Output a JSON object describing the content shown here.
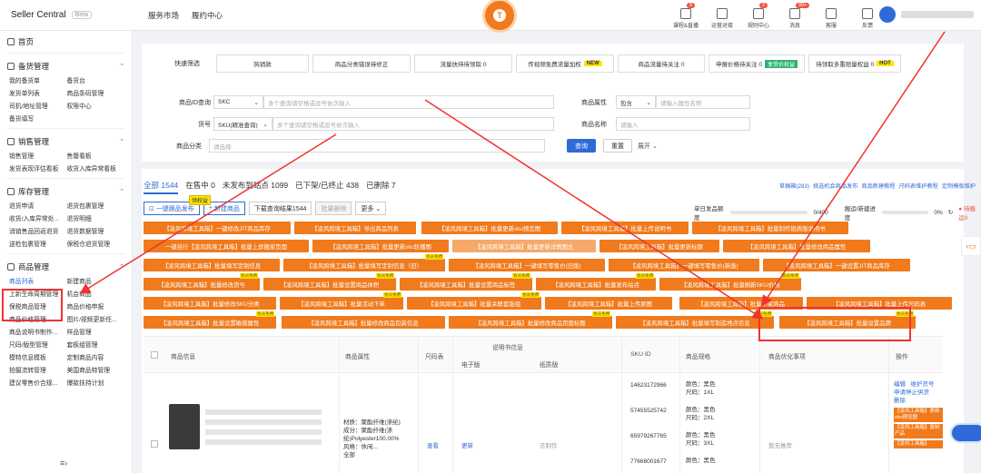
{
  "topbar": {
    "brand": "Seller Central",
    "beta": "Beta",
    "nav": [
      "服务市场",
      "履约中心"
    ],
    "icons": [
      {
        "label": "课程&直播",
        "name": "course-icon",
        "badge": "9"
      },
      {
        "label": "运营对接",
        "name": "operation-icon",
        "badge": ""
      },
      {
        "label": "规则中心",
        "name": "rules-icon",
        "badge": "2"
      },
      {
        "label": "消息",
        "name": "message-icon",
        "badge": "99+"
      },
      {
        "label": "客服",
        "name": "service-icon",
        "badge": ""
      },
      {
        "label": "反馈",
        "name": "feedback-icon",
        "badge": ""
      }
    ]
  },
  "sidebar": {
    "home": "首页",
    "sections": [
      {
        "title": "备货管理",
        "items": [
          "我的备货单",
          "备货台",
          "发货单列表",
          "商品条码管理",
          "司机/地址管理",
          "权限中心",
          "备货填写",
          ""
        ]
      },
      {
        "title": "销售管理",
        "items": [
          "销售管理",
          "售罄看板",
          "发货表现评估看板",
          "收货入库异常看板"
        ]
      },
      {
        "title": "库存管理",
        "items": [
          "退货申请",
          "退货包裹管理",
          "收货/入库异常处...",
          "退货明细",
          "消销售品回返退货",
          "退货数据管理",
          "送检包裹管理",
          "保税仓退货管理"
        ]
      },
      {
        "title": "商品管理",
        "items": [
          "商品列表",
          "新建商品",
          "上新生命周期管理",
          "机会商品",
          "保税商品管理",
          "商品价格申报",
          "商品价格管理",
          "图片/视频更新任...",
          "商品说明书制作...",
          "样品管理",
          "尺码/版型管理",
          "套板组管理",
          "模特信息模板",
          "定制商品内容",
          "拍摄流转管理",
          "美国商品特管理",
          "建议零售价合规...",
          "爆款扶持计划"
        ]
      }
    ]
  },
  "filters": {
    "label": "快速筛选",
    "items": [
      {
        "text": "热销款",
        "tag": "",
        "tag_type": ""
      },
      {
        "text": "商品分类错误待修正",
        "tag": "",
        "tag_type": ""
      },
      {
        "text": "流量扶持待领取 0",
        "tag": "",
        "tag_type": ""
      },
      {
        "text": "传视频免费流量加权",
        "tag": "NEW",
        "tag_type": "new"
      },
      {
        "text": "商品流量待关注 0",
        "tag": "",
        "tag_type": ""
      },
      {
        "text": "申报价格待关注 0",
        "tag": "享受价权益",
        "tag_type": "green"
      },
      {
        "text": "待领取多重限量权益 0",
        "tag": "HOT",
        "tag_type": "hot"
      }
    ]
  },
  "form": {
    "id_label": "商品ID查询",
    "id_select": "SKC",
    "id_placeholder": "多个查询请空格或逗号依次输入",
    "attr_label": "商品属性",
    "attr_select": "包含",
    "attr_placeholder": "请输入属性名称",
    "code_label": "货号",
    "code_select": "SKU(精准查询)",
    "code_placeholder": "多个查询请空格或逗号依次输入",
    "name_label": "商品名称",
    "name_placeholder": "请输入",
    "cat_label": "商品分类",
    "cat_placeholder": "请选择",
    "query": "查询",
    "reset": "重置",
    "expand": "展开"
  },
  "tabs": [
    "全部 1544",
    "在售中 0",
    "未发布到站点 1099",
    "已下架/已终止 438",
    "已删除 7"
  ],
  "tab_links": [
    "草稿箱(283)",
    "挑选机会商品发布",
    "商品新建教程",
    "尺码表维护教程",
    "定制模版维护"
  ],
  "actions": {
    "publish": "一键跟品发布",
    "publish_tag": "领权益",
    "new": "新建商品",
    "download": "下载查询结果1544",
    "batch_delete": "批量删除",
    "more": "更多",
    "progress_label": "单日发品额度",
    "progress_value": "0/400",
    "progress_fraction": 0,
    "sync_label": "搬运/新建进度",
    "sync_value": "0%",
    "pending": "待搬运0"
  },
  "tool_tag": "会员免费",
  "orange_buttons": [
    "【凌风跨境工具箱】一键修改JIT商品库存",
    "【凌风跨境工具箱】导出商品列表",
    "【凌风跨境工具箱】批量更新sku预览图",
    "【凌风跨境工具箱】批量上传说明书",
    "【凌风跨境工具箱】批量制作纸质版说明书",
    "一键自行【凌风跨境工具箱】批量上屏搬家页面",
    "【凌风跨境工具箱】批量更新skc轮播图",
    "【凌风跨境工具箱】批量更新详情图文",
    "【凌风跨境工具箱】批量更新标题",
    "【凌风跨境工具箱】批量修改商品属性",
    "【凌风跨境工具箱】批量填写定制信息",
    "【凌风跨境工具箱】批量填写定制信息（旧）",
    "【凌风跨境工具箱】一键填写零售价(旧版)",
    "【凌风跨境工具箱】一键填写零售价(新版)",
    "【凌风跨境工具箱】一键设置JIT商品库存",
    "【凌风跨境工具箱】批量修改货号",
    "【凌风跨境工具箱】批量设置商品体积",
    "【凌风跨境工具箱】批量设置商品标签",
    "【凌风跨境工具箱】批量发布站点",
    "【凌风跨境工具箱】批量刷新SKU价格",
    "【凌风跨境工具箱】批量修改SKU分类",
    "【凌风跨境工具箱】批量活动下单",
    "【凌风跨境工具箱】批量关联套版组",
    "【凌风跨境工具箱】批量上传原图",
    "【凌风跨境工具箱】批量下架商品",
    "【凌风跨境工具箱】批量上传尺码表",
    "【凌风跨境工具箱】批量设置敏感属性",
    "【凌风跨境工具箱】批量修改商品包装信息",
    "【凌风跨境工具箱】批量修改商品页面标题",
    "【凌风跨境工具箱】批量填写制造地点信息",
    "【凌风跨境工具箱】批量设置品牌"
  ],
  "table": {
    "headers": [
      "商品信息",
      "商品属性",
      "尺码表",
      "说明书信息",
      "SKU ID",
      "商品规格",
      "商品优化事项",
      "操作"
    ],
    "subheaders": [
      "电子版",
      "纸质版"
    ],
    "attrs": "材质：聚酯纤维(涤纶)\n成分：聚酯纤维(涤纶)Polyester100.00%\n风格：休闲...\n全部",
    "size_link": "查看",
    "ebook": "更新",
    "paper": "去制作",
    "sku_ids": [
      "14623172966",
      "57455525742",
      "65979267765",
      "77668001677"
    ],
    "specs": [
      {
        "color": "颜色：黑色",
        "size": "尺码：1XL"
      },
      {
        "color": "颜色：黑色",
        "size": "尺码：2XL"
      },
      {
        "color": "颜色：黑色",
        "size": "尺码：3XL"
      },
      {
        "color": "颜色：黑色",
        "size": ""
      }
    ],
    "optimize": "暂无推荐",
    "ops": [
      "编辑",
      "维护货号",
      "申请停止供货",
      "删除"
    ],
    "op_buttons": [
      "【凌风工具箱】更新sku预览图",
      "【凌风工具箱】复制产品",
      "【凌风工具箱】"
    ]
  },
  "colors": {
    "orange": "#f07a1c",
    "blue": "#2f6bd6",
    "red": "#e33333"
  }
}
